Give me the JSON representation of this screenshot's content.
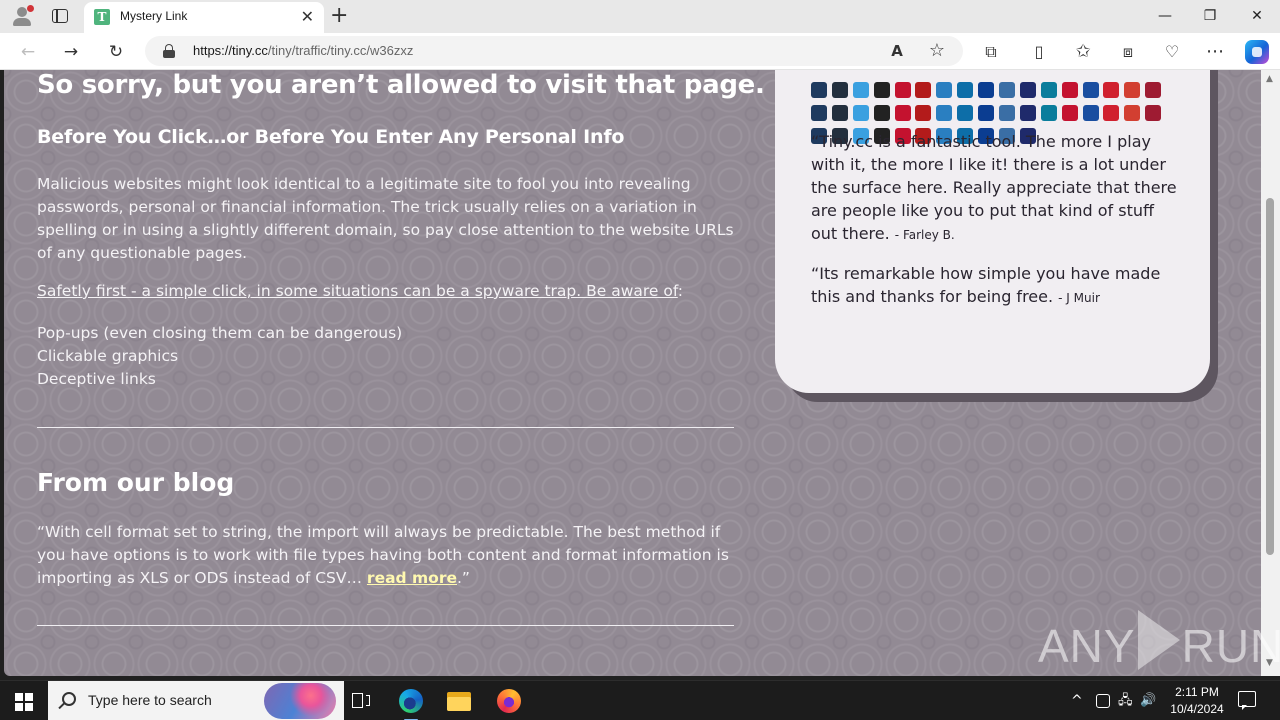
{
  "browser": {
    "tab": {
      "title": "Mystery Link",
      "favicon_letter": "T",
      "close_glyph": "✕"
    },
    "new_tab_glyph": "+",
    "window_controls": {
      "minimize": "—",
      "maximize": "❐",
      "close": "✕"
    },
    "nav": {
      "back": "←",
      "forward": "→",
      "refresh": "↻"
    },
    "address": {
      "host": "https://tiny.cc",
      "path": "/tiny/traffic/tiny.cc/w36zxz"
    },
    "toolbar_icons": {
      "read_aloud": "A",
      "favorite": "☆",
      "extensions": "⧉",
      "split": "▯",
      "favorites": "✩",
      "collections": "⧈",
      "performance": "♡",
      "more": "⋯"
    }
  },
  "page": {
    "heading": "So sorry, but you aren’t allowed to visit that page.",
    "subheading": "Before You Click…or Before You Enter Any Personal Info",
    "intro": "Malicious websites might look identical to a legitimate site to fool you into revealing passwords, personal or financial information. The trick usually relies on a variation in spelling or in using a slightly different domain, so pay close attention to the website URLs of any questionable pages.",
    "safety_link": "Safetly first - a simple click, in some situations can be a spyware trap. Be aware of",
    "safety_colon": ":",
    "warnings": [
      "Pop-ups (even closing them can be dangerous)",
      "Clickable graphics",
      "Deceptive links"
    ],
    "blog": {
      "heading": "From our blog",
      "excerpt": "“With cell format set to string, the import will always be predictable. The best method if you have options is to work with file types having both content and format information is importing as XLS or ODS instead of CSV… ",
      "read_more": "read more",
      "closing_quote": ".”"
    },
    "sidebar": {
      "logos": [
        [
          "e-icon",
          "amazon-icon",
          "aol-icon",
          "asus-icon",
          "block-icon",
          "shield-icon",
          "ball-icon",
          "cisco-icon",
          "nasa-icon",
          "sail-icon",
          "d-icon",
          "gear-icon",
          "era-icon",
          "fda-icon",
          "flip-icon",
          "colors-icon",
          "crest-icon"
        ],
        [
          "h-icon",
          "hp-icon",
          "crest-icon",
          "ring-icon",
          "k-icon",
          "house-icon",
          "globe-icon",
          "windows-icon",
          "shield-icon",
          "tower-icon",
          "arc-icon",
          "crest-icon",
          "stack-icon",
          "s-icon",
          "wheel-icon",
          "t-icon",
          "telekom-icon"
        ],
        [
          "tower-icon",
          "tl-icon",
          "usc-icon",
          "bird-icon",
          "crest-icon",
          "shield-icon",
          "jet-icon",
          "star-icon",
          "swoosh-icon",
          "ball-icon",
          "yahoo-icon"
        ]
      ],
      "logo_colors": [
        "#1e3a5f",
        "#232f3e",
        "#3aa0e0",
        "#222222",
        "#c4122f",
        "#b31b1b",
        "#2a7fc1",
        "#0d6ea8",
        "#0b3d91",
        "#3a6ea5",
        "#1f2a6b",
        "#0a7d9c",
        "#c41230",
        "#1a4ea0",
        "#d0202e",
        "#d23f31",
        "#9e1b32"
      ],
      "quotes": [
        {
          "text": "“Tiny.cc is a fantastic tool. The more I play with it, the more I like it! there is a lot under the surface here. Really appreciate that there are people like you to put that kind of stuff out there.",
          "author": "- Farley B."
        },
        {
          "text": "“Its remarkable how simple you have made this and thanks for being free.",
          "author": "- J Muir"
        }
      ]
    },
    "watermark": {
      "left": "ANY",
      "right": "RUN"
    }
  },
  "scrollbar": {
    "up": "▲",
    "down": "▼"
  },
  "taskbar": {
    "search_placeholder": "Type here to search",
    "clock": {
      "time": "2:11 PM",
      "date": "10/4/2024"
    },
    "tray": {
      "chevron": "^",
      "network": "🖧",
      "volume": "🔊"
    }
  }
}
